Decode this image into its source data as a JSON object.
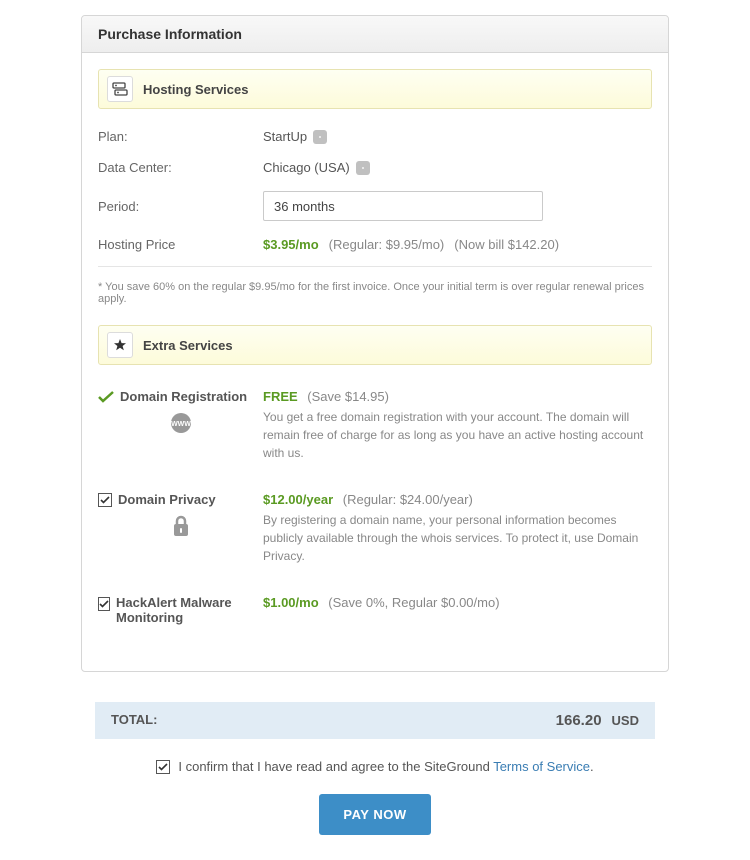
{
  "header": {
    "title": "Purchase Information"
  },
  "hosting": {
    "section_title": "Hosting Services",
    "plan_label": "Plan:",
    "plan_value": "StartUp",
    "datacenter_label": "Data Center:",
    "datacenter_value": "Chicago (USA)",
    "period_label": "Period:",
    "period_value": "36 months",
    "price_label": "Hosting Price",
    "price_value": "$3.95/mo",
    "regular": "(Regular: $9.95/mo)",
    "now_bill": "(Now bill $142.20)",
    "footnote": "* You save 60% on the regular $9.95/mo for the first invoice. Once your initial term is over regular renewal prices apply."
  },
  "extras": {
    "section_title": "Extra Services",
    "domain_reg": {
      "title": "Domain Registration",
      "price": "FREE",
      "save": "(Save $14.95)",
      "desc": "You get a free domain registration with your account. The domain will remain free of charge for as long as you have an active hosting account with us."
    },
    "domain_privacy": {
      "title": "Domain Privacy",
      "price": "$12.00/year",
      "regular": "(Regular: $24.00/year)",
      "desc": "By registering a domain name, your personal information becomes publicly available through the whois services. To protect it, use Domain Privacy."
    },
    "malware": {
      "title": "HackAlert Malware Monitoring",
      "price": "$1.00/mo",
      "regular": "(Save 0%, Regular $0.00/mo)"
    }
  },
  "total": {
    "label": "TOTAL:",
    "amount": "166.20",
    "currency": "USD"
  },
  "confirm": {
    "text_before": "I confirm that I have read and agree to the SiteGround ",
    "link": "Terms of Service",
    "text_after": "."
  },
  "pay_button": "PAY NOW"
}
